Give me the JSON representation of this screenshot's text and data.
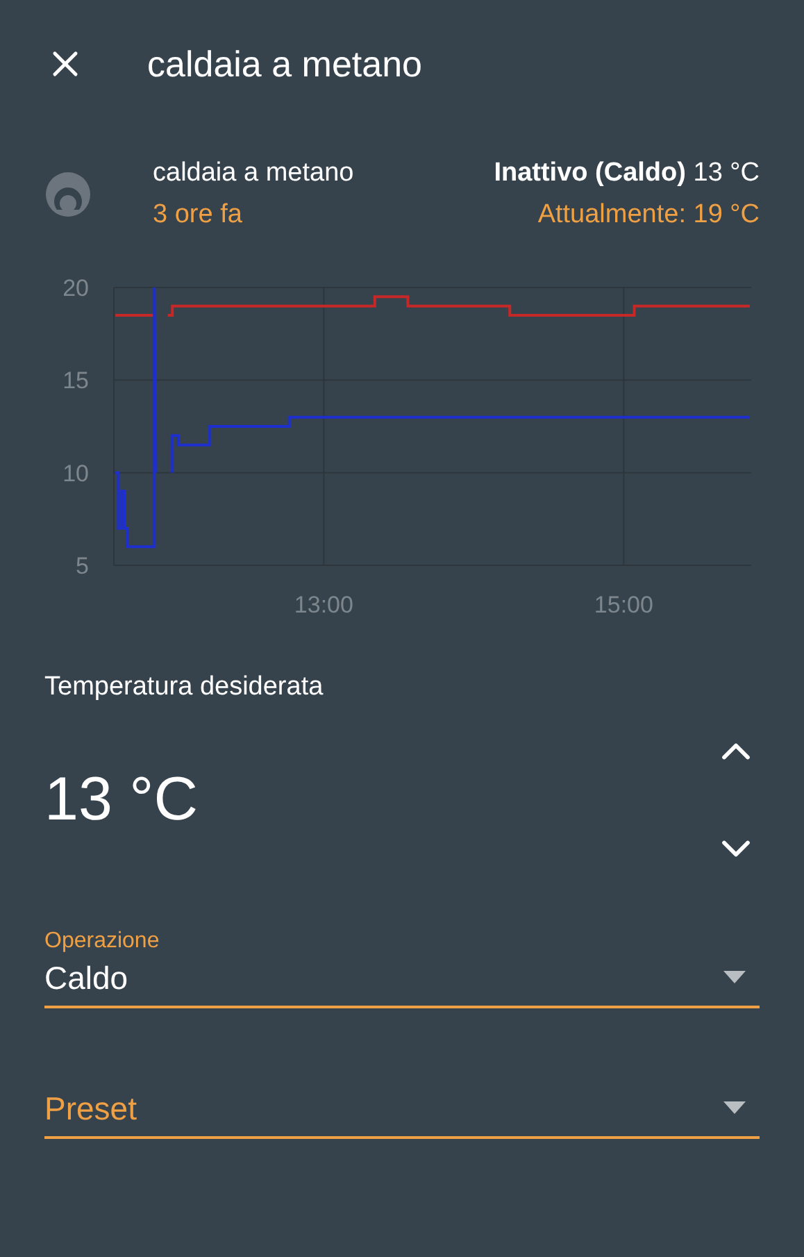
{
  "header": {
    "title": "caldaia a metano"
  },
  "entity": {
    "name": "caldaia a metano",
    "last_changed": "3 ore fa",
    "state": "**Inattivo (Caldo)** 13 °C",
    "current": "Attualmente: 19 °C"
  },
  "history": {
    "chart_data": {
      "type": "line",
      "grid": true,
      "x": [
        11.61,
        11.63,
        11.63,
        11.65,
        11.65,
        11.67,
        11.67,
        11.69,
        11.69,
        11.87,
        11.87,
        11.88,
        11.96,
        11.99,
        11.99,
        12.03,
        12.03,
        12.24,
        12.24,
        12.77,
        12.77,
        13.34,
        13.34,
        13.56,
        13.56,
        14.24,
        14.24,
        15.07,
        15.07,
        15.84
      ],
      "series": [
        {
          "color": "#c62828",
          "values": [
            18.5,
            18.5,
            18.5,
            18.5,
            18.5,
            18.5,
            18.5,
            18.5,
            18.5,
            18.5,
            null,
            null,
            18.5,
            18.5,
            19,
            19,
            19,
            19,
            19,
            19,
            19,
            19,
            19.5,
            19.5,
            19,
            19,
            18.5,
            18.5,
            19,
            19
          ]
        },
        {
          "color": "#1e2fd0",
          "values": [
            10,
            10,
            7,
            7,
            9,
            9,
            7,
            7,
            6,
            6,
            20,
            10,
            null,
            10,
            12,
            12,
            11.5,
            11.5,
            12.5,
            12.5,
            13,
            13,
            13,
            13,
            13,
            13,
            13,
            13,
            13,
            13
          ]
        }
      ],
      "xlim": [
        11.6,
        15.85
      ],
      "ylim": [
        5,
        20
      ],
      "xticks": [
        {
          "value": 13,
          "label": "13:00"
        },
        {
          "value": 15,
          "label": "15:00"
        }
      ],
      "yticks": [
        5,
        10,
        15,
        20
      ]
    }
  },
  "target": {
    "label": "Temperatura desiderata",
    "value": "13 °C"
  },
  "selects": [
    {
      "label": "Operazione",
      "value": "Caldo"
    },
    {
      "label": "Preset"
    }
  ]
}
